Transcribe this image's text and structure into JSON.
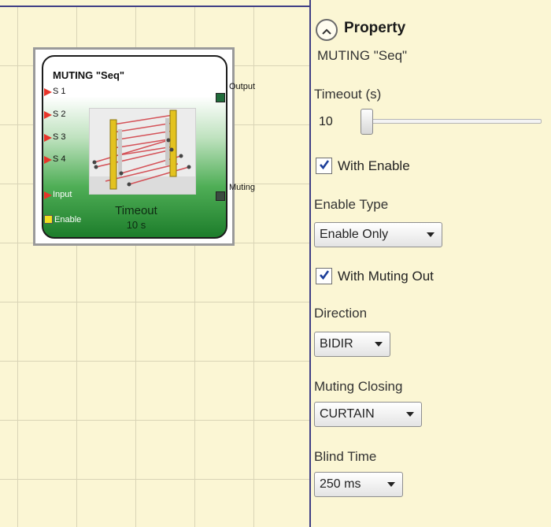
{
  "block": {
    "title": "MUTING \"Seq\"",
    "inputs": [
      "S 1",
      "S 2",
      "S 3",
      "S 4",
      "Input"
    ],
    "enable_label": "Enable",
    "outputs": [
      "Output",
      "Muting"
    ],
    "timeout_label": "Timeout",
    "timeout_value": "10 s",
    "icon": "muting-light-curtain-icon"
  },
  "property": {
    "title": "Property",
    "name": "MUTING \"Seq\"",
    "collapse_icon": "chevron-up-icon",
    "timeout_label": "Timeout (s)",
    "timeout_value": "10",
    "with_enable_label": "With Enable",
    "with_enable_checked": true,
    "enable_type_label": "Enable Type",
    "enable_type_value": "Enable Only",
    "with_muting_out_label": "With Muting Out",
    "with_muting_out_checked": true,
    "direction_label": "Direction",
    "direction_value": "BIDIR",
    "muting_closing_label": "Muting Closing",
    "muting_closing_value": "CURTAIN",
    "blind_time_label": "Blind Time",
    "blind_time_value": "250 ms"
  },
  "colors": {
    "input_port": "#e8342a",
    "enable_port": "#f0e020",
    "output_port": "#1f6b3a",
    "muting_port": "#3a4a40",
    "divider": "#3f3f86",
    "panel_bg": "#fbf6d4"
  }
}
